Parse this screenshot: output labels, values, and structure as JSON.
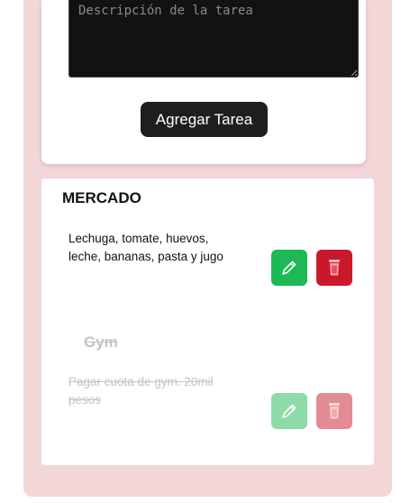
{
  "form": {
    "description_placeholder": "Descripción de la tarea",
    "description_value": "",
    "add_button_label": "Agregar Tarea"
  },
  "tasks": [
    {
      "title": "MERCADO",
      "description": "Lechuga, tomate, huevos, leche, bananas, pasta y jugo",
      "completed": false,
      "edit_icon": "pencil-icon",
      "delete_icon": "trash-icon"
    },
    {
      "title": "Gym",
      "description": "Pagar cuota de gym. 20mil pesos",
      "completed": true,
      "edit_icon": "pencil-icon",
      "delete_icon": "trash-icon"
    }
  ],
  "colors": {
    "page_background": "#f2d6d8",
    "card_background": "#ffffff",
    "add_button": "#1e1e1e",
    "edit_button": "#1db954",
    "delete_button": "#c8192b",
    "completed_text": "#c3c3c3"
  }
}
